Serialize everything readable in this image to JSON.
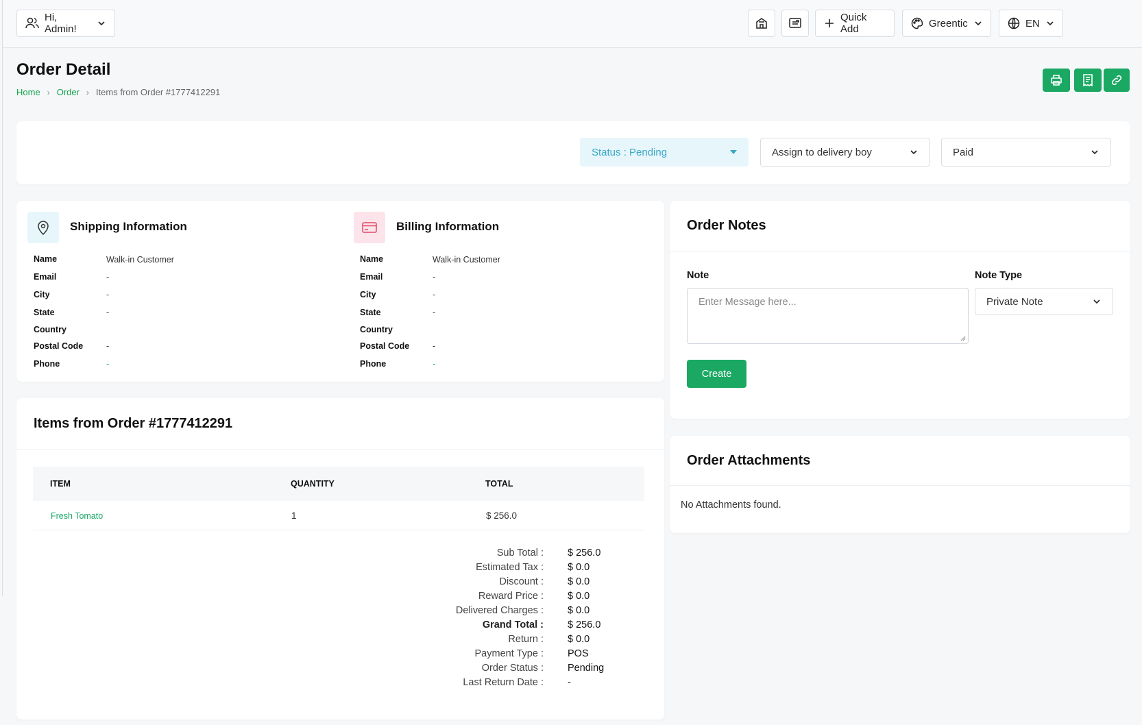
{
  "topbar": {
    "greeting": "Hi, Admin!",
    "quick_add": "Quick Add",
    "theme": "Greentic",
    "language": "EN"
  },
  "page": {
    "title": "Order Detail",
    "breadcrumb": [
      "Home",
      "Order",
      "Items from Order #1777412291"
    ]
  },
  "controls": {
    "status": "Status : Pending",
    "delivery": "Assign to delivery boy",
    "payment": "Paid"
  },
  "shipping": {
    "title": "Shipping Information",
    "fields": [
      {
        "label": "Name",
        "value": "Walk-in Customer"
      },
      {
        "label": "Email",
        "value": "-"
      },
      {
        "label": "City",
        "value": "-"
      },
      {
        "label": "State",
        "value": "-"
      },
      {
        "label": "Country",
        "value": ""
      },
      {
        "label": "Postal Code",
        "value": "-"
      },
      {
        "label": "Phone",
        "value": "-"
      }
    ]
  },
  "billing": {
    "title": "Billing Information",
    "fields": [
      {
        "label": "Name",
        "value": "Walk-in Customer"
      },
      {
        "label": "Email",
        "value": "-"
      },
      {
        "label": "City",
        "value": "-"
      },
      {
        "label": "State",
        "value": "-"
      },
      {
        "label": "Country",
        "value": ""
      },
      {
        "label": "Postal Code",
        "value": "-"
      },
      {
        "label": "Phone",
        "value": "-"
      }
    ]
  },
  "items": {
    "title": "Items from Order #1777412291",
    "headers": [
      "ITEM",
      "QUANTITY",
      "TOTAL"
    ],
    "rows": [
      {
        "item": "Fresh Tomato",
        "quantity": "1",
        "total": "$ 256.0"
      }
    ],
    "summary": [
      {
        "label": "Sub Total :",
        "value": "$ 256.0",
        "bold": false
      },
      {
        "label": "Estimated Tax :",
        "value": "$ 0.0",
        "bold": false
      },
      {
        "label": "Discount :",
        "value": "$ 0.0",
        "bold": false
      },
      {
        "label": "Reward Price :",
        "value": "$ 0.0",
        "bold": false
      },
      {
        "label": "Delivered Charges :",
        "value": "$ 0.0",
        "bold": false
      },
      {
        "label": "Grand Total :",
        "value": "$ 256.0",
        "bold": true
      },
      {
        "label": "Return :",
        "value": "$ 0.0",
        "bold": false
      },
      {
        "label": "Payment Type :",
        "value": "POS",
        "bold": false
      },
      {
        "label": "Order Status :",
        "value": "Pending",
        "bold": false
      },
      {
        "label": "Last Return Date :",
        "value": "-",
        "bold": false
      }
    ]
  },
  "notes": {
    "title": "Order Notes",
    "note_label": "Note",
    "note_placeholder": "Enter Message here...",
    "type_label": "Note Type",
    "type_value": "Private Note",
    "create": "Create"
  },
  "attachments": {
    "title": "Order Attachments",
    "empty": "No Attachments found."
  },
  "colors": {
    "accent": "#1aa863",
    "status_bg": "#e6f6fb",
    "status_text": "#3aa7c4"
  }
}
